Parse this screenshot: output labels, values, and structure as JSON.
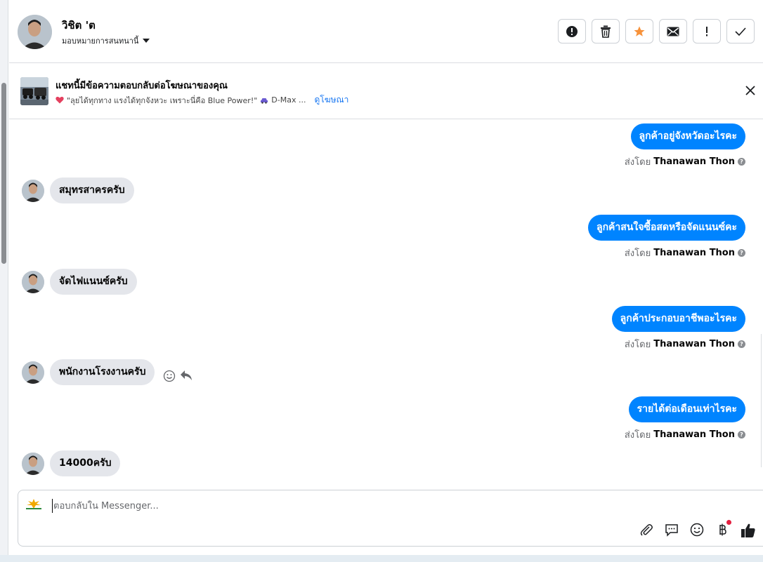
{
  "header": {
    "contact_name": "วิชิต 'ต",
    "assign_label": "มอบหมายการสนทนานี้",
    "actions": [
      {
        "name": "report-button",
        "icon": "alert-circle-icon"
      },
      {
        "name": "delete-button",
        "icon": "trash-icon"
      },
      {
        "name": "star-button",
        "icon": "star-icon"
      },
      {
        "name": "mark-unread-button",
        "icon": "envelope-icon"
      },
      {
        "name": "spam-button",
        "icon": "exclamation-icon"
      },
      {
        "name": "done-button",
        "icon": "check-icon"
      }
    ],
    "star_color": "#f7923a"
  },
  "ad_banner": {
    "title": "แชทนี้มีข้อความตอบกลับต่อโฆษณาของคุณ",
    "snippet": "\"ลุยได้ทุกทาง แรงได้ทุกจังหวะ เพราะนี่คือ Blue Power!\"",
    "snippet_tail": "D-Max ...",
    "link": "ดูโฆษณา"
  },
  "messages": [
    {
      "dir": "out",
      "text": "ลูกค้าอยู่จังหวัดอะไรคะ",
      "sent_by_prefix": "ส่งโดย",
      "sender": "Thanawan Thon"
    },
    {
      "dir": "in",
      "text": "สมุทรสาครครับ"
    },
    {
      "dir": "out",
      "text": "ลูกค้าสนใจซื้อสดหรือจัดแนนซ์คะ",
      "sent_by_prefix": "ส่งโดย",
      "sender": "Thanawan Thon"
    },
    {
      "dir": "in",
      "text": "จัดไฟแนนซ์ครับ"
    },
    {
      "dir": "out",
      "text": "ลูกค้าประกอบอาชีพอะไรคะ",
      "sent_by_prefix": "ส่งโดย",
      "sender": "Thanawan Thon"
    },
    {
      "dir": "in",
      "text": "พนักงานโรงงานครับ"
    },
    {
      "dir": "out",
      "text": "รายได้ต่อเดือนเท่าไรคะ",
      "sent_by_prefix": "ส่งโดย",
      "sender": "Thanawan Thon"
    },
    {
      "dir": "in",
      "text": "14000ครับ"
    }
  ],
  "composer": {
    "placeholder": "ตอบกลับใน Messenger..."
  },
  "colors": {
    "outgoing_bubble": "#0084ff",
    "incoming_bubble": "#e4e6eb",
    "link": "#1877f2"
  }
}
